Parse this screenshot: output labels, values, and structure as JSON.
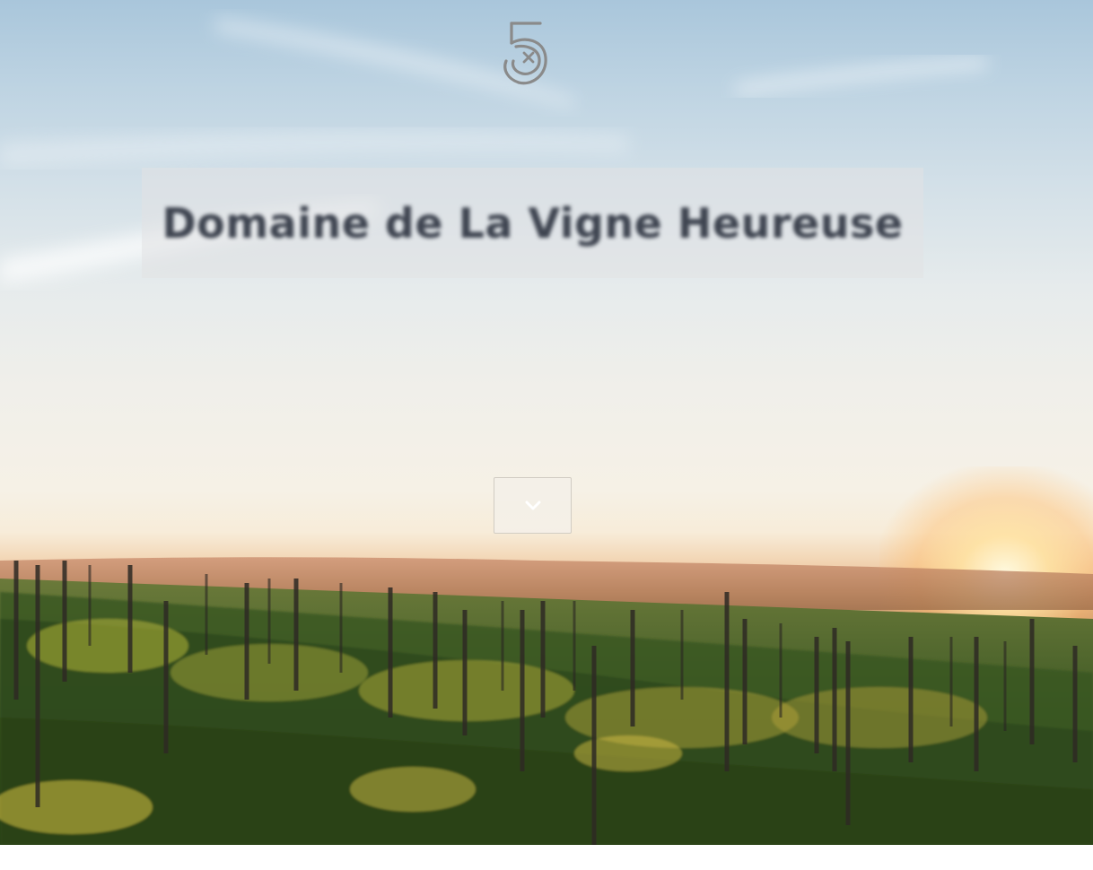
{
  "hero": {
    "title": "Domaine de La Vigne Heureuse",
    "scroll_button_icon": "chevron-down-icon"
  },
  "logo": {
    "icon": "logo-5-icon"
  },
  "colors": {
    "title_text": "#3e4450",
    "title_box": "#e1e1e4",
    "logo_stroke": "#8a8a8a"
  }
}
